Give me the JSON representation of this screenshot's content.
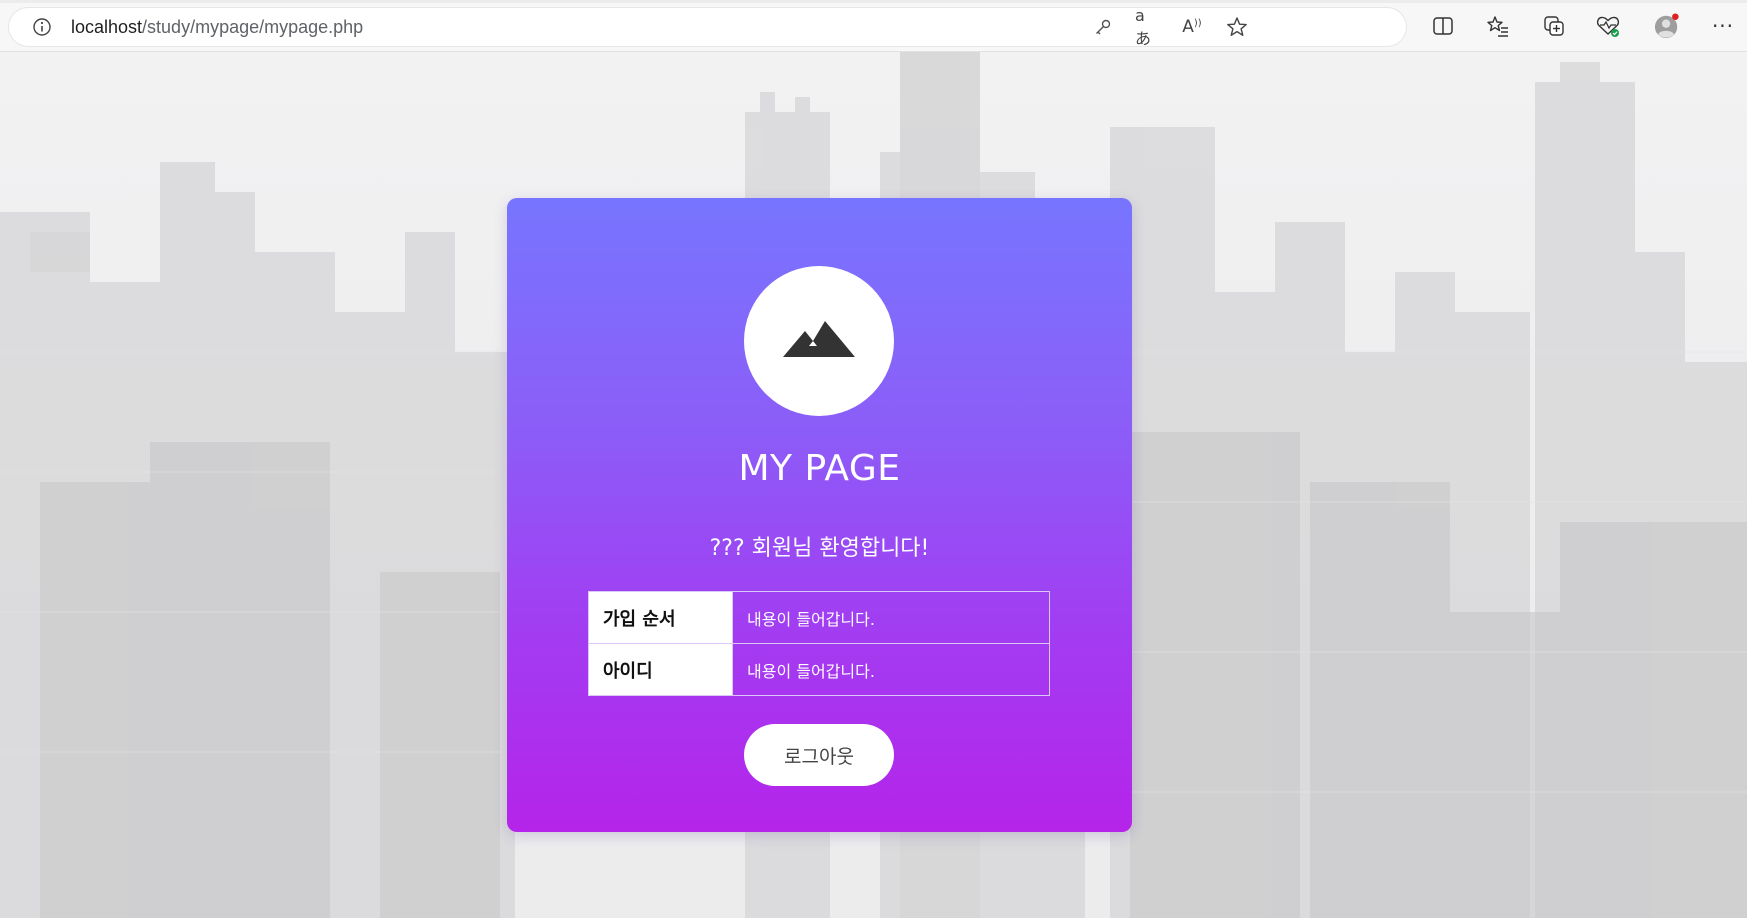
{
  "browser": {
    "url_host": "localhost",
    "url_path": "/study/mypage/mypage.php",
    "address_icons": [
      "key-icon",
      "translate-icon",
      "read-aloud-icon",
      "favorite-star-icon"
    ],
    "toolbar_icons": [
      "split-screen-icon",
      "favorites-icon",
      "collections-icon",
      "browser-essentials-icon",
      "profile-avatar-icon",
      "more-menu-icon"
    ]
  },
  "card": {
    "gradient_top": "#7775ff",
    "gradient_bottom": "#b524ea",
    "logo_icon": "mountain-icon",
    "title": "MY PAGE",
    "welcome": "??? 회원님 환영합니다!",
    "table": {
      "rows": [
        {
          "label": "가입 순서",
          "value": "내용이 들어갑니다."
        },
        {
          "label": "아이디",
          "value": "내용이 들어갑니다."
        }
      ]
    },
    "logout_label": "로그아웃"
  }
}
